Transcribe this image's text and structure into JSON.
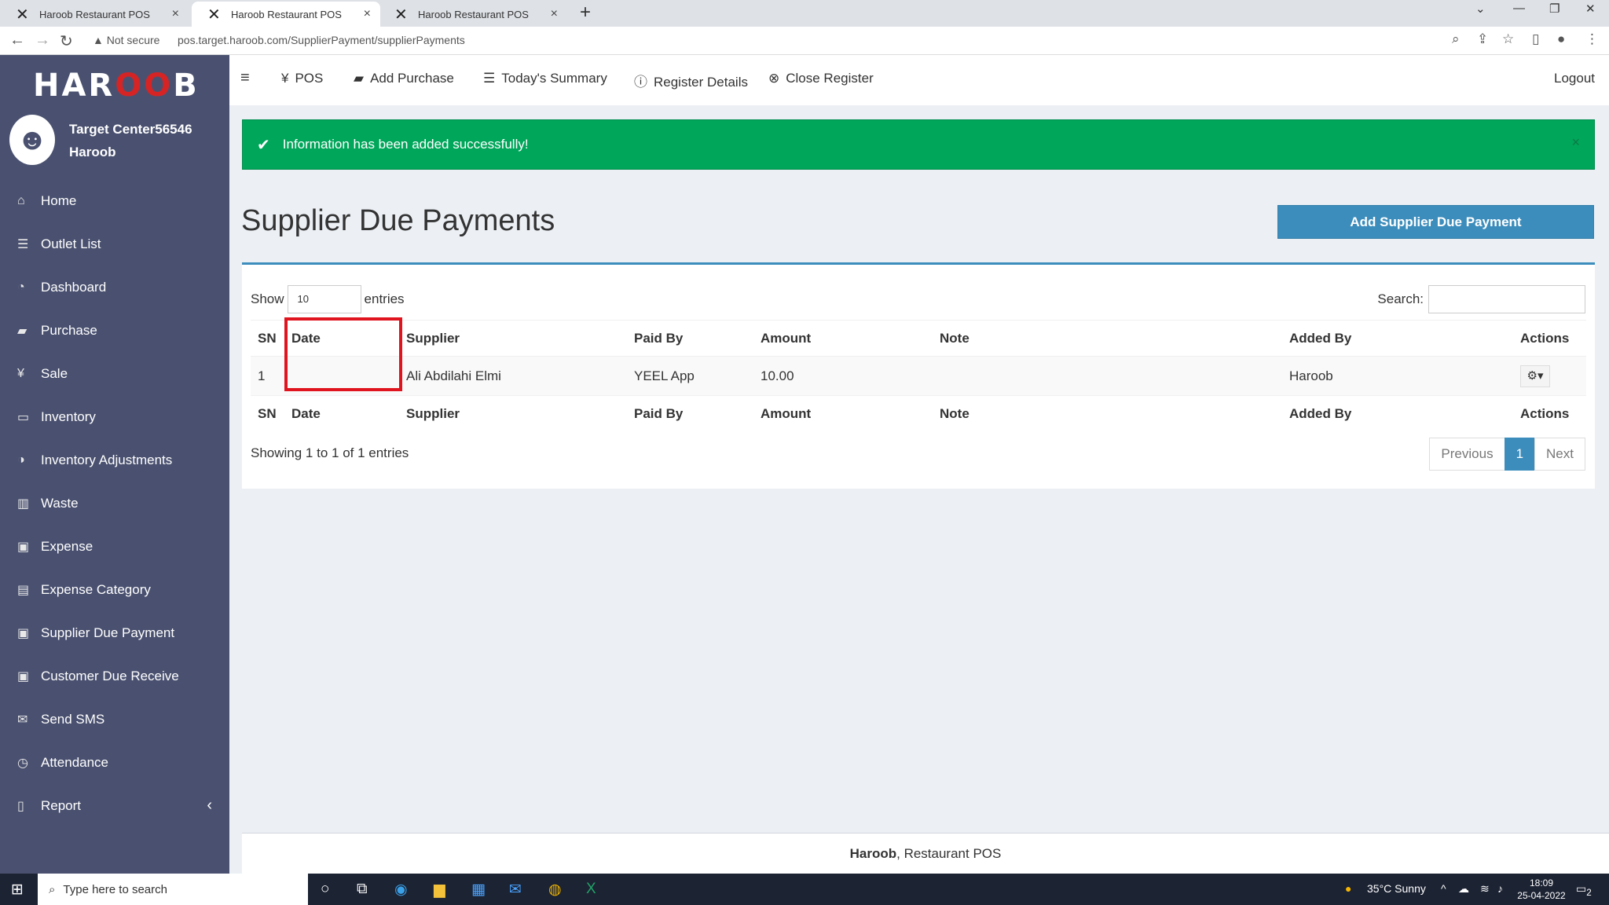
{
  "browser": {
    "tabs": [
      {
        "title": "Haroob Restaurant POS"
      },
      {
        "title": "Haroob Restaurant POS"
      },
      {
        "title": "Haroob Restaurant POS"
      }
    ],
    "security": "Not secure",
    "url": "pos.target.haroob.com/SupplierPayment/supplierPayments"
  },
  "sidebar": {
    "logo": {
      "left": "HAR",
      "mid": "OO",
      "right": "B"
    },
    "user_line1": "Target Center56546",
    "user_line2": "Haroob",
    "items": [
      {
        "label": "Home",
        "icon": "home-icon"
      },
      {
        "label": "Outlet List",
        "icon": "list-icon"
      },
      {
        "label": "Dashboard",
        "icon": "dashboard-icon"
      },
      {
        "label": "Purchase",
        "icon": "truck-icon"
      },
      {
        "label": "Sale",
        "icon": "cutlery-icon"
      },
      {
        "label": "Inventory",
        "icon": "hdd-icon"
      },
      {
        "label": "Inventory Adjustments",
        "icon": "adjust-icon"
      },
      {
        "label": "Waste",
        "icon": "trash-icon"
      },
      {
        "label": "Expense",
        "icon": "money-icon"
      },
      {
        "label": "Expense Category",
        "icon": "list-alt-icon"
      },
      {
        "label": "Supplier Due Payment",
        "icon": "money-icon"
      },
      {
        "label": "Customer Due Receive",
        "icon": "money-icon"
      },
      {
        "label": "Send SMS",
        "icon": "envelope-icon"
      },
      {
        "label": "Attendance",
        "icon": "clock-icon"
      },
      {
        "label": "Report",
        "icon": "file-icon"
      }
    ]
  },
  "topnav": {
    "pos": "POS",
    "add_purchase": "Add Purchase",
    "todays_summary": "Today's Summary",
    "register_details": "Register Details",
    "close_register": "Close Register",
    "logout": "Logout"
  },
  "alert": {
    "message": "Information has been added successfully!"
  },
  "page": {
    "title": "Supplier Due Payments",
    "add_button": "Add Supplier Due Payment"
  },
  "table": {
    "show_label": "Show",
    "entries_value": "10",
    "entries_label": "entries",
    "search_label": "Search:",
    "columns": [
      "SN",
      "Date",
      "Supplier",
      "Paid By",
      "Amount",
      "Note",
      "Added By",
      "Actions"
    ],
    "rows": [
      {
        "sn": "1",
        "date": "",
        "supplier": "Ali Abdilahi Elmi",
        "paid_by": "YEEL App",
        "amount": "10.00",
        "note": "",
        "added_by": "Haroob"
      }
    ],
    "info": "Showing 1 to 1 of 1 entries",
    "pagination": {
      "previous": "Previous",
      "current": "1",
      "next": "Next"
    }
  },
  "footer": {
    "brand": "Haroob",
    "text": ", Restaurant POS"
  },
  "taskbar": {
    "search_placeholder": "Type here to search",
    "weather": "35°C  Sunny",
    "time": "18:09",
    "date": "25-04-2022",
    "notifications": "2"
  },
  "colors": {
    "sidebar": "#4a5170",
    "success": "#00a65a",
    "primary": "#3c8dbc",
    "highlight": "#e0141e"
  }
}
